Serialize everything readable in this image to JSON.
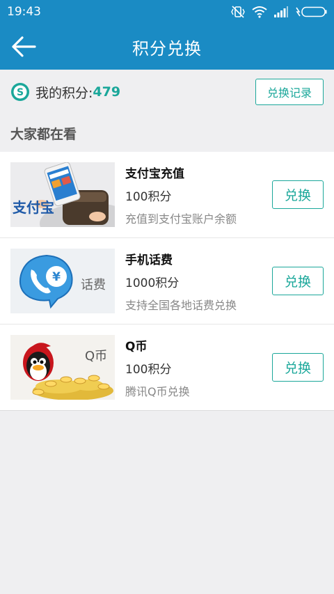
{
  "status": {
    "time": "19:43"
  },
  "header": {
    "title": "积分兑换"
  },
  "points": {
    "label": "我的积分:",
    "value": "479",
    "record_button": "兑换记录"
  },
  "section": {
    "title": "大家都在看"
  },
  "items": [
    {
      "title": "支付宝充值",
      "points": "100积分",
      "desc": "充值到支付宝账户余额",
      "button": "兑换",
      "thumb_text": "支付宝"
    },
    {
      "title": "手机话费",
      "points": "1000积分",
      "desc": "支持全国各地话费兑换",
      "button": "兑换",
      "thumb_text": "话费"
    },
    {
      "title": "Q币",
      "points": "100积分",
      "desc": "腾讯Q币兑换",
      "button": "兑换",
      "thumb_text": "Q币"
    }
  ],
  "colors": {
    "primary": "#1a8bc4",
    "accent": "#1aa79a",
    "background": "#efeff1"
  },
  "icons": [
    "back-arrow-icon",
    "points-s-icon",
    "vibrate-icon",
    "wifi-icon",
    "signal-icon",
    "battery-icon"
  ]
}
